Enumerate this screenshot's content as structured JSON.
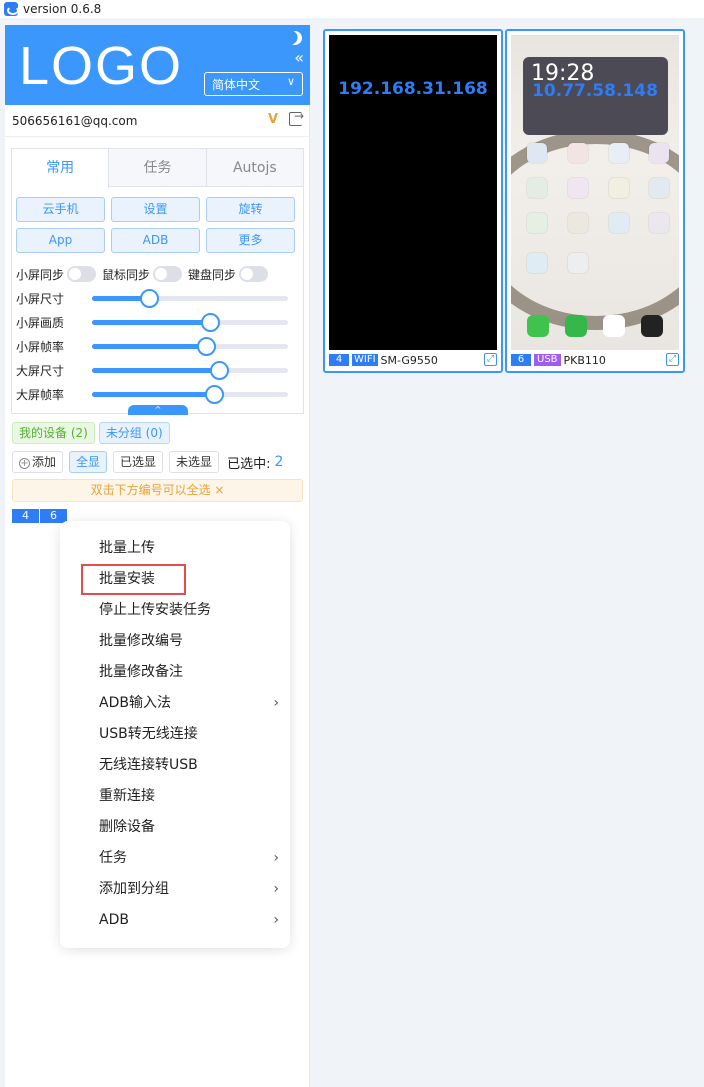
{
  "window": {
    "version": "version 0.6.8"
  },
  "header": {
    "logo": "LOGO",
    "language": "简体中文"
  },
  "account": {
    "email": "506656161@qq.com"
  },
  "tabs": [
    "常用",
    "任务",
    "Autojs"
  ],
  "buttons": [
    "云手机",
    "设置",
    "旋转",
    "App",
    "ADB",
    "更多"
  ],
  "sync": [
    {
      "label": "小屏同步",
      "on": false
    },
    {
      "label": "鼠标同步",
      "on": false
    },
    {
      "label": "键盘同步",
      "on": false
    }
  ],
  "sliders": [
    {
      "label": "小屏尺寸",
      "value": 0.29
    },
    {
      "label": "小屏画质",
      "value": 0.6
    },
    {
      "label": "小屏帧率",
      "value": 0.58
    },
    {
      "label": "大屏尺寸",
      "value": 0.65
    },
    {
      "label": "大屏帧率",
      "value": 0.62
    }
  ],
  "groups": {
    "mine": "我的设备 (2)",
    "ungrouped": "未分组 (0)"
  },
  "filters": {
    "add": "添加",
    "all": "全显",
    "selected": "已选显",
    "unselected": "未选显",
    "selected_label": "已选中:",
    "selected_count": "2"
  },
  "notice": "双击下方编号可以全选 ×",
  "device_numbers": [
    "4",
    "6"
  ],
  "menu": [
    {
      "label": "批量上传",
      "submenu": false
    },
    {
      "label": "批量安装",
      "submenu": false,
      "highlighted": true
    },
    {
      "label": "停止上传安装任务",
      "submenu": false
    },
    {
      "label": "批量修改编号",
      "submenu": false
    },
    {
      "label": "批量修改备注",
      "submenu": false
    },
    {
      "label": "ADB输入法",
      "submenu": true
    },
    {
      "label": "USB转无线连接",
      "submenu": false
    },
    {
      "label": "无线连接转USB",
      "submenu": false
    },
    {
      "label": "重新连接",
      "submenu": false
    },
    {
      "label": "删除设备",
      "submenu": false
    },
    {
      "label": "任务",
      "submenu": true
    },
    {
      "label": "添加到分组",
      "submenu": true
    },
    {
      "label": "ADB",
      "submenu": true
    }
  ],
  "devices": [
    {
      "num": "4",
      "conn": "WIFI",
      "model": "SM-G9550",
      "ip": "192.168.31.168"
    },
    {
      "num": "6",
      "conn": "USB",
      "model": "PKB110",
      "ip": "10.77.58.148",
      "clock": "19:28"
    }
  ],
  "colors": {
    "accent": "#3b97fb",
    "highlight": "#e44b4b",
    "usb": "#a05cf5"
  }
}
